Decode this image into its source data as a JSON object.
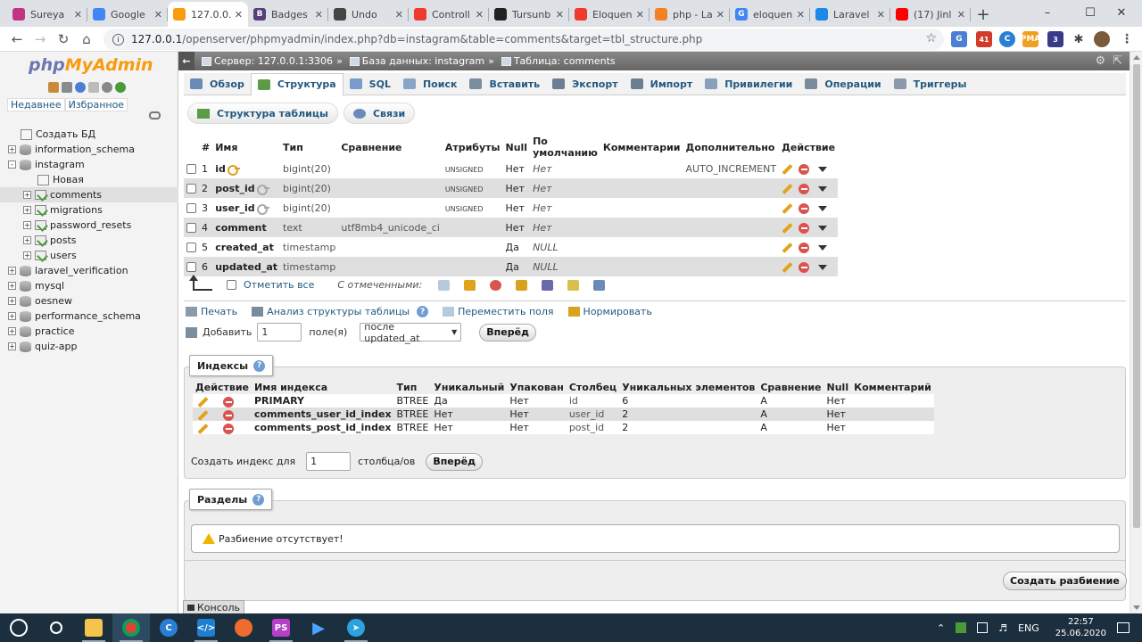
{
  "browser": {
    "tabs": [
      {
        "title": "Sureya",
        "color": "#c13584",
        "letter": "",
        "active": false
      },
      {
        "title": "Google",
        "color": "#4285f4",
        "letter": "",
        "active": false
      },
      {
        "title": "127.0.0.",
        "color": "#f89c0e",
        "letter": "",
        "active": true
      },
      {
        "title": "Badges",
        "color": "#563d7c",
        "letter": "B",
        "active": false
      },
      {
        "title": "Undo",
        "color": "#444444",
        "letter": "",
        "active": false
      },
      {
        "title": "Controll",
        "color": "#ef3b2d",
        "letter": "",
        "active": false
      },
      {
        "title": "Tursunb",
        "color": "#222222",
        "letter": "",
        "active": false
      },
      {
        "title": "Eloquen",
        "color": "#ef3b2d",
        "letter": "",
        "active": false
      },
      {
        "title": "php - La",
        "color": "#f48024",
        "letter": "",
        "active": false
      },
      {
        "title": "eloquen",
        "color": "#4285f4",
        "letter": "G",
        "active": false
      },
      {
        "title": "Laravel",
        "color": "#1e88e5",
        "letter": "",
        "active": false
      },
      {
        "title": "(17) Jinl",
        "color": "#ff0000",
        "letter": "",
        "active": false
      }
    ],
    "url_host": "127.0.0.1",
    "url_path": "/openserver/phpmyadmin/index.php?db=instagram&table=comments&target=tbl_structure.php",
    "ext_badges": {
      "mail": "41",
      "b": "3"
    },
    "colors": {
      "accent": "#235a81"
    }
  },
  "nav": {
    "logo_php": "php",
    "logo_my": "MyAdmin",
    "recent": "Недавнее",
    "favorites": "Избранное",
    "create_db": "Создать БД",
    "databases": [
      {
        "name": "information_schema",
        "expanded": false
      },
      {
        "name": "instagram",
        "expanded": true
      },
      {
        "name": "laravel_verification",
        "expanded": false
      },
      {
        "name": "mysql",
        "expanded": false
      },
      {
        "name": "oesnew",
        "expanded": false
      },
      {
        "name": "performance_schema",
        "expanded": false
      },
      {
        "name": "practice",
        "expanded": false
      },
      {
        "name": "quiz-app",
        "expanded": false
      }
    ],
    "new_table": "Новая",
    "tables": [
      "comments",
      "migrations",
      "password_resets",
      "posts",
      "users"
    ],
    "selected_table": "comments"
  },
  "main": {
    "breadcrumb": {
      "server": "Сервер: 127.0.0.1:3306",
      "database": "База данных: instagram",
      "table": "Таблица: comments"
    },
    "menu": [
      {
        "label": "Обзор",
        "icon": "browse-icon",
        "color": "#6a8ab8"
      },
      {
        "label": "Структура",
        "icon": "structure-icon",
        "color": "#5b9b4a",
        "active": true
      },
      {
        "label": "SQL",
        "icon": "sql-icon",
        "color": "#7a9ccc"
      },
      {
        "label": "Поиск",
        "icon": "search-icon",
        "color": "#8aa4c8"
      },
      {
        "label": "Вставить",
        "icon": "insert-icon",
        "color": "#7a8ea0"
      },
      {
        "label": "Экспорт",
        "icon": "export-icon",
        "color": "#6b7f94"
      },
      {
        "label": "Импорт",
        "icon": "import-icon",
        "color": "#6b7f94"
      },
      {
        "label": "Привилегии",
        "icon": "privileges-icon",
        "color": "#8aa0b8"
      },
      {
        "label": "Операции",
        "icon": "operations-icon",
        "color": "#7a8c9c"
      },
      {
        "label": "Триггеры",
        "icon": "triggers-icon",
        "color": "#8a9aaa"
      }
    ],
    "subtabs": [
      "Структура таблицы",
      "Связи"
    ],
    "structure": {
      "headers": [
        "#",
        "Имя",
        "Тип",
        "Сравнение",
        "Атрибуты",
        "Null",
        "По умолчанию",
        "Комментарии",
        "Дополнительно",
        "Действие"
      ],
      "rows": [
        {
          "num": "1",
          "name": "id",
          "key": "primary",
          "type": "bigint(20)",
          "collation": "",
          "attr": "UNSIGNED",
          "null": "Нет",
          "default": "Нет",
          "comment": "",
          "extra": "AUTO_INCREMENT"
        },
        {
          "num": "2",
          "name": "post_id",
          "key": "index",
          "type": "bigint(20)",
          "collation": "",
          "attr": "UNSIGNED",
          "null": "Нет",
          "default": "Нет",
          "comment": "",
          "extra": ""
        },
        {
          "num": "3",
          "name": "user_id",
          "key": "index",
          "type": "bigint(20)",
          "collation": "",
          "attr": "UNSIGNED",
          "null": "Нет",
          "default": "Нет",
          "comment": "",
          "extra": ""
        },
        {
          "num": "4",
          "name": "comment",
          "key": "",
          "type": "text",
          "collation": "utf8mb4_unicode_ci",
          "attr": "",
          "null": "Нет",
          "default": "Нет",
          "comment": "",
          "extra": ""
        },
        {
          "num": "5",
          "name": "created_at",
          "key": "",
          "type": "timestamp",
          "collation": "",
          "attr": "",
          "null": "Да",
          "default": "NULL",
          "comment": "",
          "extra": ""
        },
        {
          "num": "6",
          "name": "updated_at",
          "key": "",
          "type": "timestamp",
          "collation": "",
          "attr": "",
          "null": "Да",
          "default": "NULL",
          "comment": "",
          "extra": ""
        }
      ],
      "check_all": "Отметить все",
      "with_selected": "С отмеченными:"
    },
    "actions": {
      "print": "Печать",
      "analyze": "Анализ структуры таблицы",
      "move_columns": "Переместить поля",
      "normalize": "Нормировать"
    },
    "add": {
      "label": "Добавить",
      "count": "1",
      "fields": "поле(я)",
      "position": "после updated_at",
      "go": "Вперёд"
    },
    "indexes": {
      "title": "Индексы",
      "headers": [
        "Действие",
        "Имя индекса",
        "Тип",
        "Уникальный",
        "Упакован",
        "Столбец",
        "Уникальных элементов",
        "Сравнение",
        "Null",
        "Комментарий"
      ],
      "rows": [
        {
          "name": "PRIMARY",
          "type": "BTREE",
          "unique": "Да",
          "packed": "Нет",
          "column": "id",
          "cardinality": "6",
          "collation": "A",
          "null": "Нет",
          "comment": ""
        },
        {
          "name": "comments_user_id_index",
          "type": "BTREE",
          "unique": "Нет",
          "packed": "Нет",
          "column": "user_id",
          "cardinality": "2",
          "collation": "A",
          "null": "Нет",
          "comment": ""
        },
        {
          "name": "comments_post_id_index",
          "type": "BTREE",
          "unique": "Нет",
          "packed": "Нет",
          "column": "post_id",
          "cardinality": "2",
          "collation": "A",
          "null": "Нет",
          "comment": ""
        }
      ],
      "create_label": "Создать индекс для",
      "create_count": "1",
      "create_suffix": "столбца/ов",
      "go": "Вперёд"
    },
    "partitions": {
      "title": "Разделы",
      "message": "Разбиение отсутствует!",
      "create": "Создать разбиение"
    },
    "console": "Консоль"
  },
  "taskbar": {
    "lang": "ENG",
    "time": "22:57",
    "date": "25.06.2020"
  }
}
